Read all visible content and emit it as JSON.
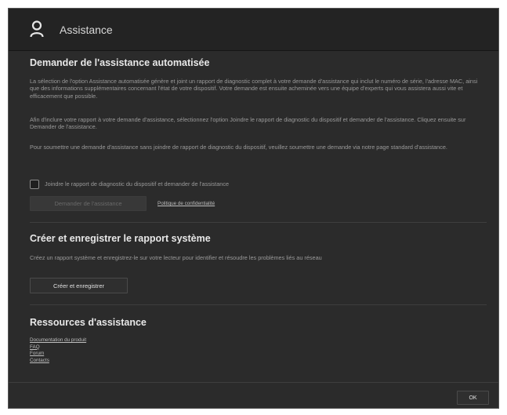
{
  "header": {
    "title": "Assistance",
    "icon": "user-icon"
  },
  "auto_support": {
    "title": "Demander de l'assistance automatisée",
    "para1": "La sélection de l'option Assistance automatisée génère et joint un rapport de diagnostic complet à votre demande d'assistance qui inclut le numéro de série, l'adresse MAC, ainsi que des informations supplémentaires concernant l'état de votre dispositif. Votre demande est ensuite acheminée vers une équipe d'experts qui vous assistera aussi vite et efficacement que possible.",
    "para2": "Afin d'inclure votre rapport à votre demande d'assistance, sélectionnez l'option Joindre le rapport de diagnostic du dispositif et demander de l'assistance. Cliquez ensuite sur Demander de l'assistance.",
    "para3": "Pour soumettre une demande d'assistance sans joindre de rapport de diagnostic du dispositif, veuillez soumettre une demande via notre page standard d'assistance.",
    "checkbox_label": "Joindre le rapport de diagnostic du dispositif et demander de l'assistance",
    "checkbox_checked": false,
    "request_button": "Demander de l'assistance",
    "privacy_link": "Politique de confidentialité"
  },
  "system_report": {
    "title": "Créer et enregistrer le rapport système",
    "para": "Créez un rapport système et enregistrez-le sur votre lecteur pour identifier et résoudre les problèmes liés au réseau",
    "button": "Créer et enregistrer"
  },
  "resources": {
    "title": "Ressources d'assistance",
    "links": [
      "Documentation du produit",
      "FAQ",
      "Forum",
      "Contacts"
    ]
  },
  "footer": {
    "ok_button": "OK"
  }
}
